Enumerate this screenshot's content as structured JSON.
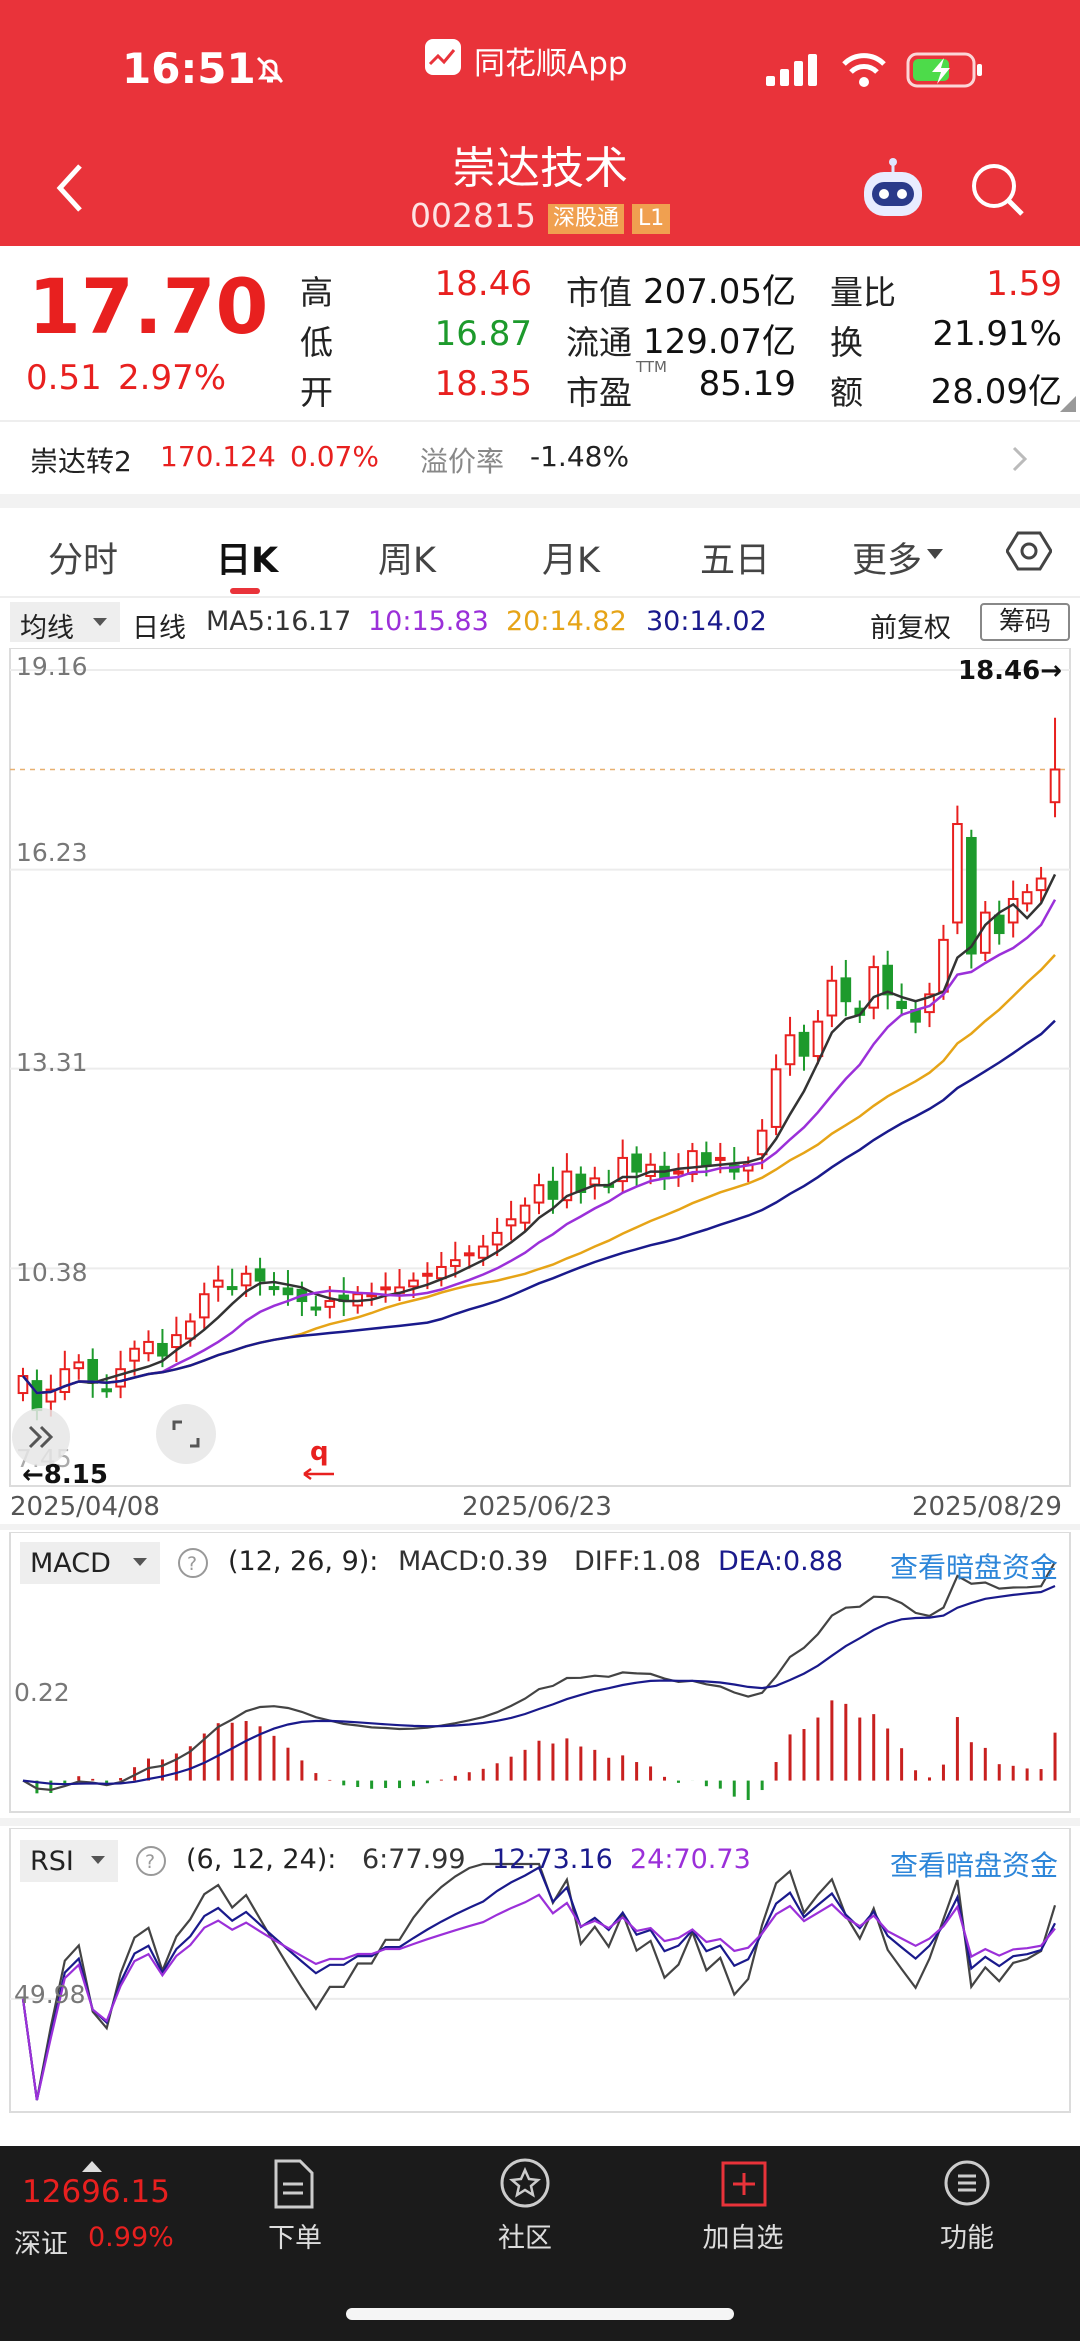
{
  "status_bar": {
    "time": "16:51",
    "app_label": "同花顺App"
  },
  "header": {
    "title": "崇达技术",
    "code": "002815",
    "badge1": "深股通",
    "badge2": "L1"
  },
  "quote": {
    "price": "17.70",
    "change": "0.51",
    "change_pct": "2.97%",
    "high_label": "高",
    "high": "18.46",
    "low_label": "低",
    "low": "16.87",
    "open_label": "开",
    "open": "18.35",
    "mcap_label": "市值",
    "mcap": "207.05亿",
    "float_label": "流通",
    "float": "129.07亿",
    "pe_label": "市盈",
    "pe_sup": "TTM",
    "pe": "85.19",
    "vol_ratio_label": "量比",
    "vol_ratio": "1.59",
    "turnover_label": "换",
    "turnover": "21.91%",
    "amount_label": "额",
    "amount": "28.09亿"
  },
  "convertible": {
    "name": "崇达转2",
    "price": "170.124",
    "change": "0.07%",
    "premium_label": "溢价率",
    "premium": "-1.48%"
  },
  "tabs": [
    "分时",
    "日K",
    "周K",
    "月K",
    "五日",
    "更多"
  ],
  "tabs_active": 1,
  "ma_bar": {
    "dropdown": "均线",
    "period": "日线",
    "ma5": "MA5:16.17",
    "ma10": "10:15.83",
    "ma20": "20:14.82",
    "ma30": "30:14.02",
    "adjust": "前复权",
    "chip": "筹码"
  },
  "kchart": {
    "y_labels": [
      "19.16",
      "16.23",
      "13.31",
      "10.38",
      "7.45"
    ],
    "max_label": "18.46→",
    "min_label": "←8.15",
    "x_labels": [
      "2025/04/08",
      "2025/06/23",
      "2025/08/29"
    ]
  },
  "macd": {
    "dropdown": "MACD",
    "params": "(12, 26, 9):",
    "macd": "MACD:0.39",
    "diff": "DIFF:1.08",
    "dea": "DEA:0.88",
    "link": "查看暗盘资金",
    "y_label": "0.22"
  },
  "rsi": {
    "dropdown": "RSI",
    "params": "(6, 12, 24):",
    "rsi6": "6:77.99",
    "rsi12": "12:73.16",
    "rsi24": "24:70.73",
    "link": "查看暗盘资金",
    "y_label": "49.98"
  },
  "bottom_nav": {
    "index_value": "12696.15",
    "index_name": "深证",
    "index_change": "0.99%",
    "items": [
      "下单",
      "社区",
      "加自选",
      "功能"
    ]
  },
  "chart_data": {
    "type": "candlestick",
    "x_range": [
      "2025/04/08",
      "2025/08/29"
    ],
    "ylim": [
      7.45,
      19.16
    ],
    "high": 18.46,
    "low": 8.15,
    "last_close": 17.7,
    "ma": {
      "MA5": 16.17,
      "MA10": 15.83,
      "MA20": 14.82,
      "MA30": 14.02
    },
    "closes_approx": [
      8.8,
      8.3,
      8.6,
      8.9,
      9.0,
      8.7,
      8.6,
      8.9,
      9.2,
      9.3,
      9.1,
      9.4,
      9.6,
      10.0,
      10.2,
      10.1,
      10.3,
      10.2,
      10.1,
      10.0,
      9.9,
      9.8,
      9.9,
      9.9,
      10.0,
      10.0,
      10.1,
      10.1,
      10.2,
      10.3,
      10.4,
      10.5,
      10.6,
      10.7,
      10.9,
      11.1,
      11.3,
      11.6,
      11.4,
      11.8,
      11.5,
      11.7,
      11.6,
      12.0,
      11.8,
      11.9,
      11.7,
      11.8,
      12.1,
      11.9,
      12.0,
      11.8,
      11.9,
      12.4,
      13.3,
      13.8,
      13.5,
      14.0,
      14.6,
      14.3,
      14.1,
      14.8,
      14.4,
      14.2,
      14.0,
      14.4,
      15.2,
      16.9,
      15.0,
      15.6,
      15.3,
      15.8,
      15.9,
      16.1,
      17.7
    ]
  }
}
